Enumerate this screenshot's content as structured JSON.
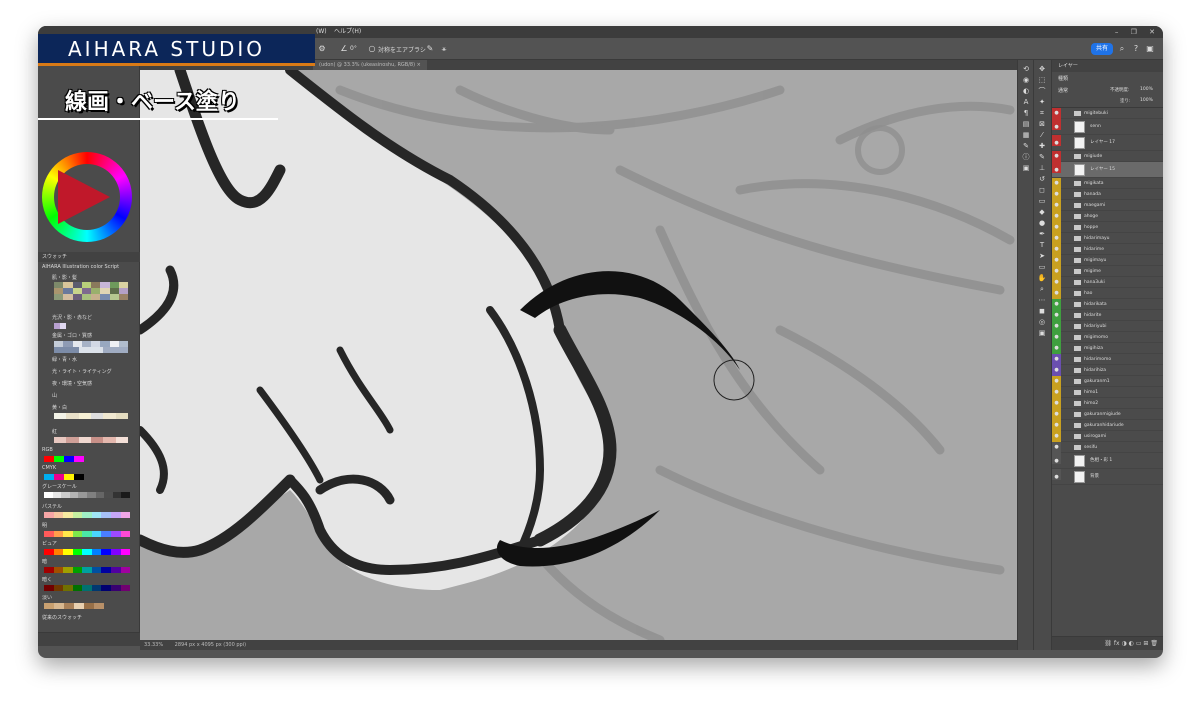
{
  "banner": {
    "studio": "AIHARA STUDIO",
    "title": "線画・ベース塗り"
  },
  "menu": {
    "help": "ヘルプ(H)",
    "window": "(W)"
  },
  "options": {
    "angle": "0°",
    "smoothing_label": "対称をエアブラシ",
    "share": "共有"
  },
  "document": {
    "tab": "(udon) @ 33.3% (ukeasinoshu, RGB/8)",
    "close": "×"
  },
  "status": {
    "zoom": "33.33%",
    "dims": "2894 px x 4095 px (300 ppi)"
  },
  "left_panel": {
    "swatches_tab": "スウォッチ",
    "groups": [
      {
        "label": "AIHARA Illustration color Script"
      },
      {
        "label": "肌・影・髪"
      },
      {
        "label": "光沢・影・赤など"
      },
      {
        "label": "金属・ゴロ・質感"
      },
      {
        "label": "緑・青・水"
      },
      {
        "label": "光・ライト・ライティング"
      },
      {
        "label": "夜・環境・空気感"
      },
      {
        "label": "山"
      },
      {
        "label": "黄・白"
      },
      {
        "label": "紅"
      },
      {
        "label": "RGB"
      },
      {
        "label": "CMYK"
      },
      {
        "label": "グレースケール"
      },
      {
        "label": "パステル"
      },
      {
        "label": "明"
      },
      {
        "label": "ピュア"
      },
      {
        "label": "暗"
      },
      {
        "label": "暗く"
      },
      {
        "label": "淡い"
      },
      {
        "label": "従来のスウォッチ"
      }
    ]
  },
  "layers_panel": {
    "tab": "レイヤー",
    "filter": "種類",
    "blend": "通常",
    "opacity_label": "不透明度:",
    "opacity": "100%",
    "fill_label": "塗り:",
    "fill": "100%",
    "layers": [
      {
        "name": "migitebuki",
        "kind": "folder",
        "color": "#c03030"
      },
      {
        "name": "senn",
        "kind": "thumb",
        "color": "#c03030"
      },
      {
        "name": "レイヤー 17",
        "kind": "thumb",
        "color": "#c03030"
      },
      {
        "name": "migiude",
        "kind": "folder",
        "color": "#c03030"
      },
      {
        "name": "レイヤー 15",
        "kind": "thumb",
        "color": "#c03030",
        "selected": true
      },
      {
        "name": "migikata",
        "kind": "folder",
        "color": "#c8a020"
      },
      {
        "name": "hanada",
        "kind": "folder",
        "color": "#c8a020"
      },
      {
        "name": "maegami",
        "kind": "folder",
        "color": "#c8a020"
      },
      {
        "name": "ahoge",
        "kind": "folder",
        "color": "#c8a020"
      },
      {
        "name": "hoppe",
        "kind": "folder",
        "color": "#c8a020"
      },
      {
        "name": "hidarimayu",
        "kind": "folder",
        "color": "#c8a020"
      },
      {
        "name": "hidarime",
        "kind": "folder",
        "color": "#c8a020"
      },
      {
        "name": "migimayu",
        "kind": "folder",
        "color": "#c8a020"
      },
      {
        "name": "migime",
        "kind": "folder",
        "color": "#c8a020"
      },
      {
        "name": "hana3uki",
        "kind": "folder",
        "color": "#c8a020"
      },
      {
        "name": "hao",
        "kind": "folder",
        "color": "#c8a020"
      },
      {
        "name": "hidarikata",
        "kind": "folder",
        "color": "#3f9f3f"
      },
      {
        "name": "hidarite",
        "kind": "folder",
        "color": "#3f9f3f"
      },
      {
        "name": "hidariyubi",
        "kind": "folder",
        "color": "#3f9f3f"
      },
      {
        "name": "migimomo",
        "kind": "folder",
        "color": "#3f9f3f"
      },
      {
        "name": "migihiza",
        "kind": "folder",
        "color": "#3f9f3f"
      },
      {
        "name": "hidarimomo",
        "kind": "folder",
        "color": "#6a4fb0"
      },
      {
        "name": "hidarihiza",
        "kind": "folder",
        "color": "#6a4fb0"
      },
      {
        "name": "gakuranm1",
        "kind": "folder",
        "color": "#c8a020"
      },
      {
        "name": "himo1",
        "kind": "folder",
        "color": "#c8a020"
      },
      {
        "name": "himo2",
        "kind": "folder",
        "color": "#c8a020"
      },
      {
        "name": "gakuranmigiude",
        "kind": "folder",
        "color": "#c8a020"
      },
      {
        "name": "gakuranhidariude",
        "kind": "folder",
        "color": "#c8a020"
      },
      {
        "name": "usirogami",
        "kind": "folder",
        "color": "#c8a020"
      },
      {
        "name": "sesifu",
        "kind": "folder",
        "color": "#555555"
      },
      {
        "name": "色相・彩 1",
        "kind": "thumb",
        "color": "#555555"
      },
      {
        "name": "背景",
        "kind": "thumb",
        "color": "#555555"
      }
    ]
  },
  "colors": {
    "panel": "#535353",
    "canvas": "#a8a8a8",
    "banner": "#0c2659",
    "banner_accent": "#d97a16",
    "share": "#1f73e8"
  }
}
